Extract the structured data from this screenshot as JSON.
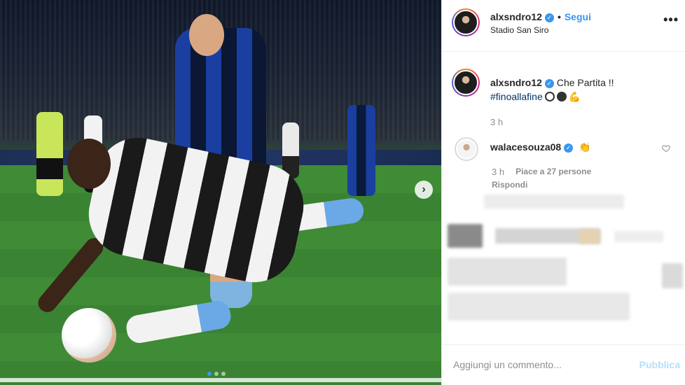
{
  "post": {
    "username": "alxsndro12",
    "follow_separator": "•",
    "follow_label": "Segui",
    "location": "Stadio San Siro",
    "more_icon": "•••",
    "next_icon": "›",
    "carousel_dots": 3,
    "carousel_active": 1
  },
  "caption": {
    "username": "alxsndro12",
    "text": "Che Partita !!",
    "hashtag": "#finoallafine",
    "emoji_muscle": "💪",
    "time": "3 h"
  },
  "comments": [
    {
      "username": "walacesouza08",
      "text": "👏",
      "time": "3 h",
      "likes": "Piace a 27 persone",
      "reply_label": "Rispondi"
    }
  ],
  "composer": {
    "placeholder": "Aggiungi un commento...",
    "publish_label": "Pubblica"
  },
  "colors": {
    "accent": "#3897f0",
    "publish_disabled": "#b2dffc",
    "meta_gray": "#8e8e8e",
    "hashtag": "#003569"
  },
  "icons": {
    "verified": "verified-badge-icon",
    "more": "more-options-icon",
    "heart": "heart-icon",
    "next": "chevron-right-icon"
  }
}
